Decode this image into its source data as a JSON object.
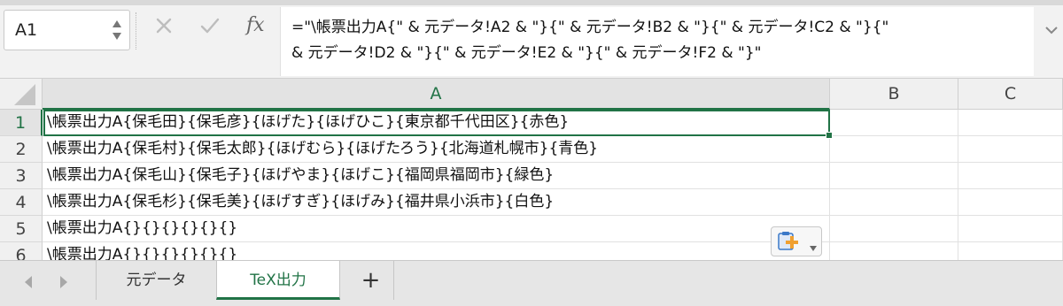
{
  "formula_bar": {
    "name_box": "A1",
    "fx_label": "fx",
    "formula": "=\"\\帳票出力A{\" & 元データ!A2 & \"}{\" & 元データ!B2 & \"}{\" & 元データ!C2 & \"}{\"\n& 元データ!D2 & \"}{\" & 元データ!E2 & \"}{\" & 元データ!F2 & \"}\""
  },
  "columns": [
    "A",
    "B",
    "C"
  ],
  "rows": [
    {
      "num": "1",
      "a": "\\帳票出力A{保毛田}{保毛彦}{ほげた}{ほげひこ}{東京都千代田区}{赤色}"
    },
    {
      "num": "2",
      "a": "\\帳票出力A{保毛村}{保毛太郎}{ほげむら}{ほげたろう}{北海道札幌市}{青色}"
    },
    {
      "num": "3",
      "a": "\\帳票出力A{保毛山}{保毛子}{ほげやま}{ほげこ}{福岡県福岡市}{緑色}"
    },
    {
      "num": "4",
      "a": "\\帳票出力A{保毛杉}{保毛美}{ほげすぎ}{ほげみ}{福井県小浜市}{白色}"
    },
    {
      "num": "5",
      "a": "\\帳票出力A{}{}{}{}{}{}"
    },
    {
      "num": "6",
      "a": "\\帳票出力A{}{}{}{}{}{}"
    }
  ],
  "sheet_tabs": [
    {
      "label": "元データ",
      "active": false
    },
    {
      "label": "TeX出力",
      "active": true
    }
  ],
  "add_sheet_label": "+",
  "colors": {
    "accent": "#217346",
    "header_bg": "#f0f0f0",
    "orange": "#f0a030",
    "blue": "#3a78c8"
  },
  "icons": [
    "stepper-arrows-icon",
    "cancel-x-icon",
    "confirm-check-icon",
    "expand-chevron-icon",
    "paste-options-icon",
    "dropdown-triangle-icon",
    "nav-left-icon",
    "nav-right-icon"
  ]
}
